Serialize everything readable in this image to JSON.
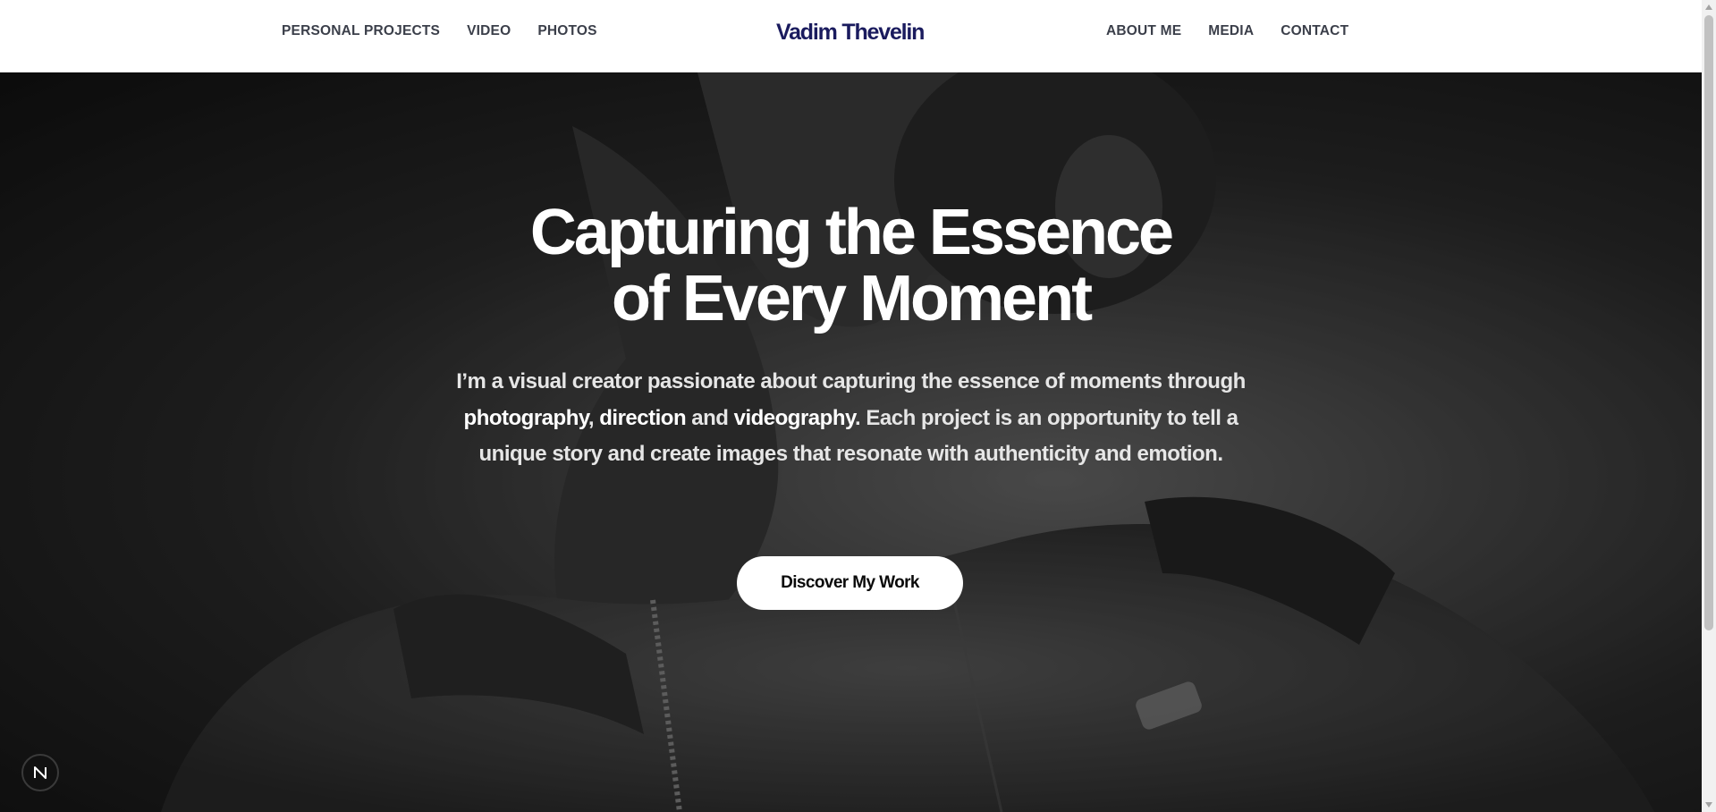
{
  "header": {
    "nav_left": [
      {
        "label": "PERSONAL PROJECTS"
      },
      {
        "label": "VIDEO"
      },
      {
        "label": "PHOTOS"
      }
    ],
    "logo": "Vadim Thevelin",
    "nav_right": [
      {
        "label": "ABOUT ME"
      },
      {
        "label": "MEDIA"
      },
      {
        "label": "CONTACT"
      }
    ]
  },
  "hero": {
    "headline_line1": "Capturing the Essence",
    "headline_line2": "of Every Moment",
    "intro": {
      "part1": "I’m a visual creator passionate about capturing the essence of moments through ",
      "bold1": "photography",
      "sep1": ", ",
      "bold2": "direction",
      "sep2": " and ",
      "bold3": "videography",
      "part2": ". Each project is an opportunity to tell a unique story and create images that resonate with authenticity and emotion."
    },
    "cta_label": "Discover My Work"
  },
  "dev_badge": {
    "letter": "N"
  },
  "colors": {
    "logo": "#1a1b5e",
    "nav_text": "#3b3f4a",
    "hero_text": "#ffffff"
  }
}
